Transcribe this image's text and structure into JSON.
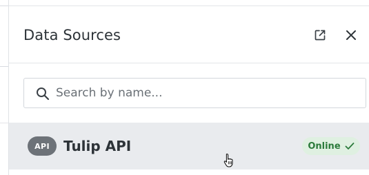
{
  "panel": {
    "title": "Data Sources",
    "icons": {
      "external": "external-link-icon",
      "close": "close-icon"
    }
  },
  "search": {
    "placeholder": "Search by name...",
    "value": "",
    "icon": "search-icon"
  },
  "sources": [
    {
      "type": "API",
      "name": "Tulip API",
      "status": "Online",
      "status_icon": "check-icon"
    }
  ],
  "colors": {
    "status_online_bg": "#dff0e1",
    "status_online_text": "#2b7a3b",
    "badge_bg": "#6d7278",
    "row_hover_bg": "#e9ebee"
  }
}
